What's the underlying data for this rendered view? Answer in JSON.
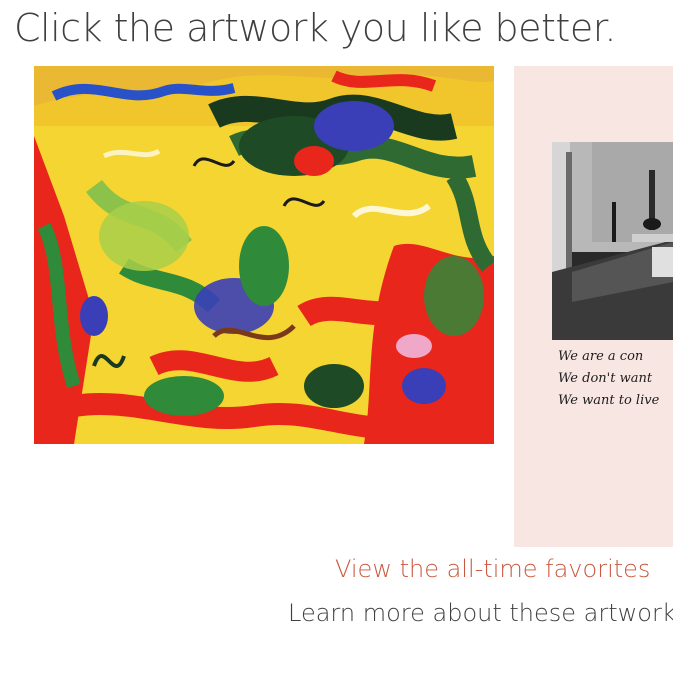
{
  "prompt": {
    "text": "Click the artwork you like better."
  },
  "artworks": {
    "left": {
      "kind": "abstract-expressionist-painting",
      "palette": [
        "#f5d531",
        "#e8261b",
        "#2f8a3a",
        "#3a3fb8",
        "#1a3a1f",
        "#8cc24a"
      ]
    },
    "right": {
      "kind": "photo-with-handwritten-caption",
      "background": "#f8e6e3",
      "caption_lines": [
        "We are a con",
        "We don't want",
        "We want to live"
      ]
    }
  },
  "links": {
    "favorites": "View the all-time favorites",
    "learn_more": "Learn more about these artworks"
  },
  "colors": {
    "link_accent": "#c9583f",
    "text": "#3f3f3f"
  }
}
